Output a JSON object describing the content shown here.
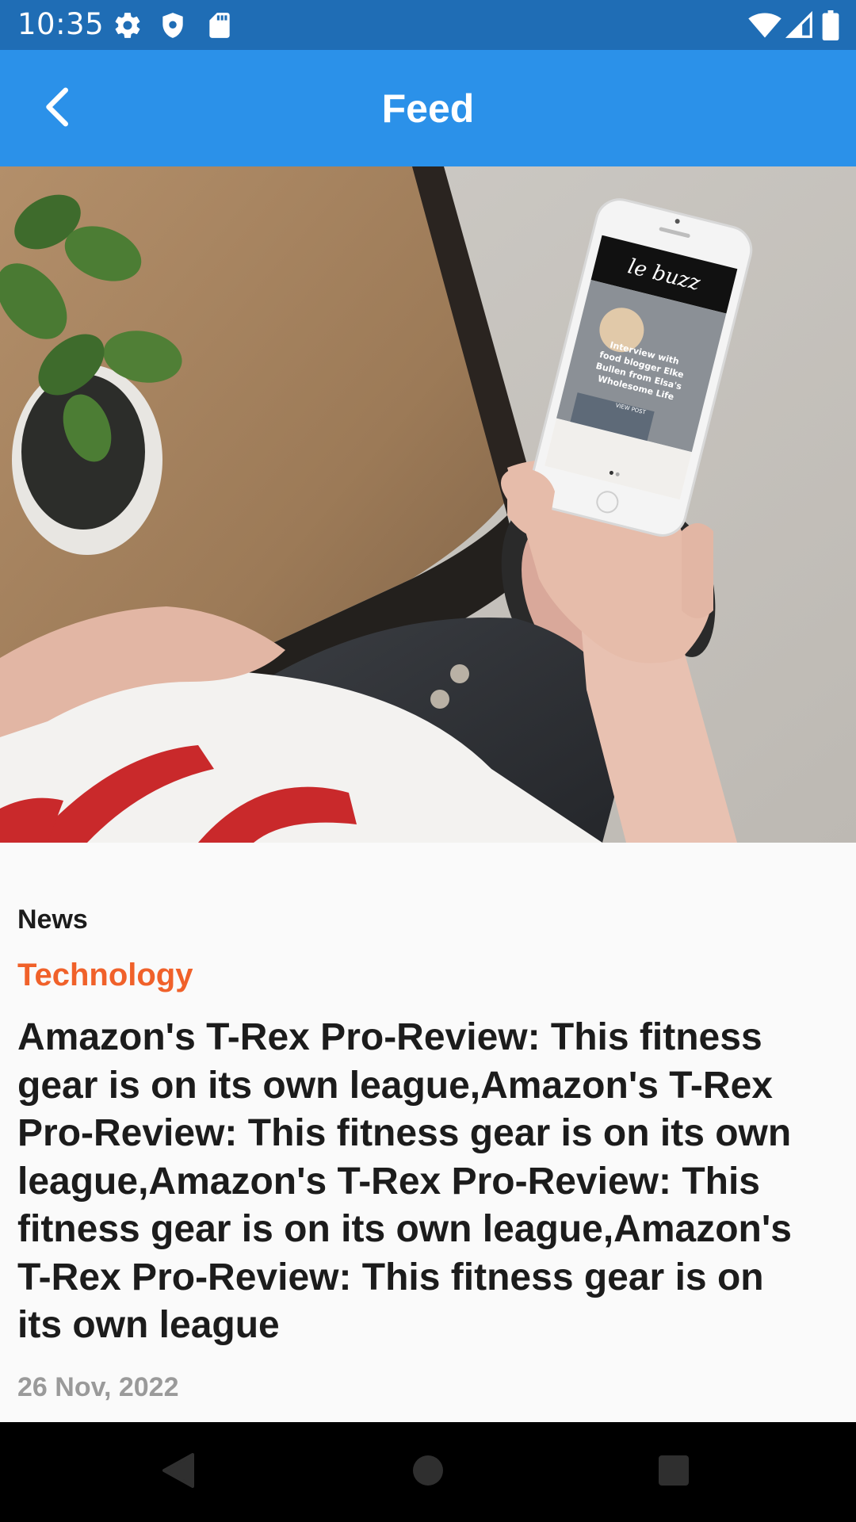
{
  "status_bar": {
    "time": "10:35",
    "icons_left": [
      "gear-icon",
      "shield-icon",
      "sd-card-icon"
    ],
    "icons_right": [
      "wifi-icon",
      "signal-icon",
      "battery-icon"
    ],
    "background": "#1f6db5"
  },
  "app_bar": {
    "title": "Feed",
    "back_icon": "chevron-left-icon",
    "background": "#2b91e9"
  },
  "hero_image": {
    "phone_screen": {
      "brand": "le buzz",
      "headline": "Interview with food blogger Elke Bullen from Elsa's Wholesome Life",
      "button": "VIEW POST"
    }
  },
  "article": {
    "section": "News",
    "category": "Technology",
    "category_color": "#f0612a",
    "headline": "Amazon's T-Rex Pro-Review: This fitness gear is on its own league,Amazon's T-Rex Pro-Review: This fitness gear is on its own league,Amazon's T-Rex Pro-Review: This fitness gear is on its own league,Amazon's T-Rex Pro-Review: This fitness gear is on its own league",
    "date": "26 Nov, 2022"
  },
  "nav_bar": {
    "buttons": [
      "back-triangle-icon",
      "home-circle-icon",
      "recents-square-icon"
    ]
  }
}
